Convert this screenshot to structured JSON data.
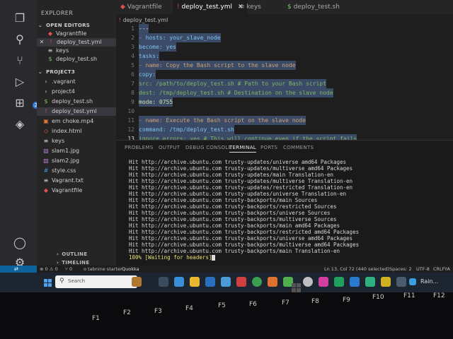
{
  "tabs": [
    {
      "label": "Vagrantfile"
    },
    {
      "label": "deploy_test.yml"
    },
    {
      "label": "keys"
    },
    {
      "label": "deploy_test.sh"
    }
  ],
  "breadcrumb": "deploy_test.yml",
  "explorer": {
    "title": "EXPLORER",
    "open_editors_label": "OPEN EDITORS",
    "open_editors": [
      "Vagrantfile",
      "deploy_test.yml",
      "keys",
      "deploy_test.sh"
    ],
    "project_label": "PROJECT3",
    "files": [
      ".vagrant",
      "project4",
      "deploy_test.sh",
      "deploy_test.yml",
      "em choke.mp4",
      "index.html",
      "keys",
      "slam1.jpg",
      "slam2.jpg",
      "style.css",
      "Vagrant.txt",
      "Vagrantfile"
    ],
    "outline_label": "OUTLINE",
    "timeline_label": "TIMELINE",
    "badge_count": "2"
  },
  "editor": {
    "line_numbers": [
      "1",
      "2",
      "3",
      "4",
      "5",
      "6",
      "7",
      "8",
      "9",
      "10",
      "11",
      "12",
      "13"
    ],
    "lines": [
      "---",
      "- hosts: your_slave_node",
      "  become: yes",
      "  tasks:",
      "    - name: Copy the Bash script to the slave node",
      "      copy:",
      "        src: /path/to/deploy_test.sh  # Path to your Bash script",
      "        dest: /tmp/deploy_test.sh    # Destination on the slave node",
      "        mode: 0755",
      "",
      "    - name: Execute the Bash script on the slave node",
      "      command: /tmp/deploy_test.sh",
      "      ignore_errors: yes  # This will continue even if the script fails"
    ]
  },
  "panel": {
    "tabs": [
      "PROBLEMS",
      "OUTPUT",
      "DEBUG CONSOLE",
      "TERMINAL",
      "PORTS",
      "COMMENTS"
    ],
    "active_tab": "TERMINAL",
    "terminal_lines": [
      "Hit http://archive.ubuntu.com trusty-updates/universe amd64 Packages",
      "Hit http://archive.ubuntu.com trusty-updates/multiverse amd64 Packages",
      "Hit http://archive.ubuntu.com trusty-updates/main Translation-en",
      "Hit http://archive.ubuntu.com trusty-updates/multiverse Translation-en",
      "Hit http://archive.ubuntu.com trusty-updates/restricted Translation-en",
      "Hit http://archive.ubuntu.com trusty-updates/universe Translation-en",
      "Hit http://archive.ubuntu.com trusty-backports/main Sources",
      "Hit http://archive.ubuntu.com trusty-backports/restricted Sources",
      "Hit http://archive.ubuntu.com trusty-backports/universe Sources",
      "Hit http://archive.ubuntu.com trusty-backports/multiverse Sources",
      "Hit http://archive.ubuntu.com trusty-backports/main amd64 Packages",
      "Hit http://archive.ubuntu.com trusty-backports/restricted amd64 Packages",
      "Hit http://archive.ubuntu.com trusty-backports/universe amd64 Packages",
      "Hit http://archive.ubuntu.com trusty-backports/multiverse amd64 Packages",
      "Hit http://archive.ubuntu.com trusty-backports/main Translation-en"
    ],
    "progress_line": "100% [Waiting for headers]"
  },
  "statusbar": {
    "errors": "⊗ 0 ⚠ 0",
    "ports": "⑂ 0",
    "tabnine": "o tabnine starter",
    "position": "Ln 13, Col 72 (440 selected)",
    "spaces": "Spaces: 2",
    "encoding": "UTF-8",
    "eol": "CRLF",
    "language": "YA"
  },
  "taskbar": {
    "search_placeholder": "Search",
    "quokka": "Quokka",
    "weather": "Rain..."
  },
  "keyboard": [
    "F1",
    "F2",
    "F3",
    "F4",
    "F5",
    "F6",
    "F7",
    "F8",
    "F9",
    "F10",
    "F11",
    "F12"
  ],
  "colors": {
    "accent": "#0e639c",
    "selection": "#3b4a66",
    "terminal_progress": "#e8e070"
  }
}
